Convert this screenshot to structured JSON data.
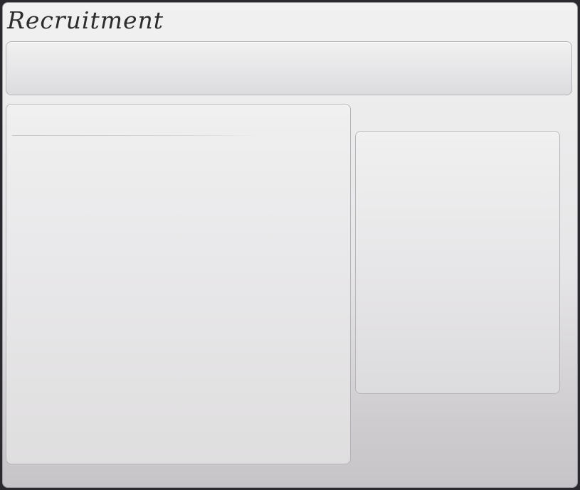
{
  "app": {
    "title": "Recruitment"
  },
  "colors": {
    "background_top": "#f1f1f1",
    "background_bottom": "#c6c4c6",
    "panel_border": "#b6b4b8",
    "title_text": "#2c2c2c"
  }
}
